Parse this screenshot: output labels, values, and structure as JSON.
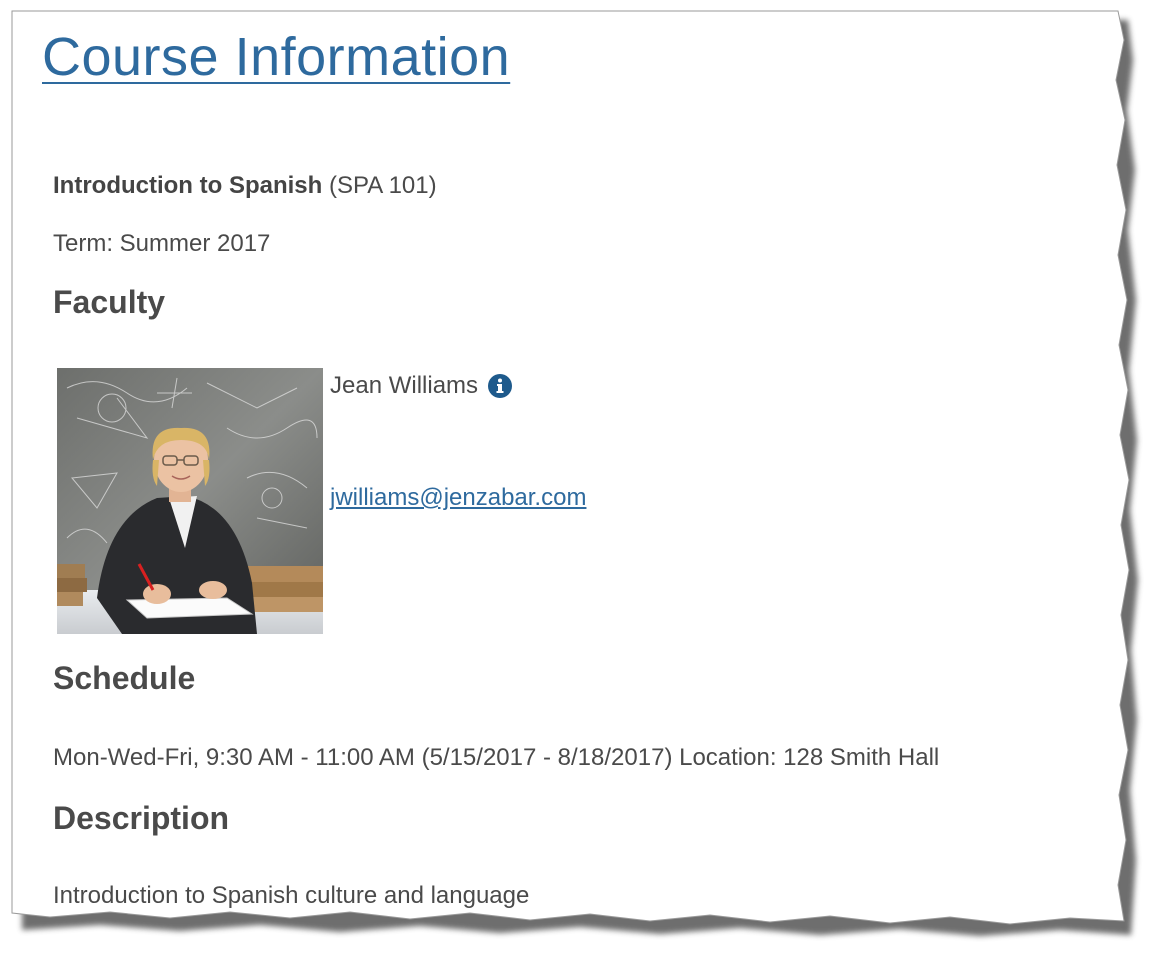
{
  "page": {
    "title": "Course Information"
  },
  "course": {
    "name": "Introduction to Spanish",
    "code": "(SPA 101)",
    "term": "Term: Summer 2017"
  },
  "faculty": {
    "heading": "Faculty",
    "name": "Jean Williams",
    "email": "jwilliams@jenzabar.com",
    "info_icon": "info-circle-icon"
  },
  "schedule": {
    "heading": "Schedule",
    "text": "Mon-Wed-Fri, 9:30 AM - 11:00 AM (5/15/2017 - 8/18/2017) Location: 128 Smith Hall"
  },
  "description": {
    "heading": "Description",
    "text": "Introduction to Spanish culture and language"
  },
  "colors": {
    "link": "#2e6a9e",
    "text": "#4a4a4a",
    "info_icon": "#1e5a8c"
  }
}
